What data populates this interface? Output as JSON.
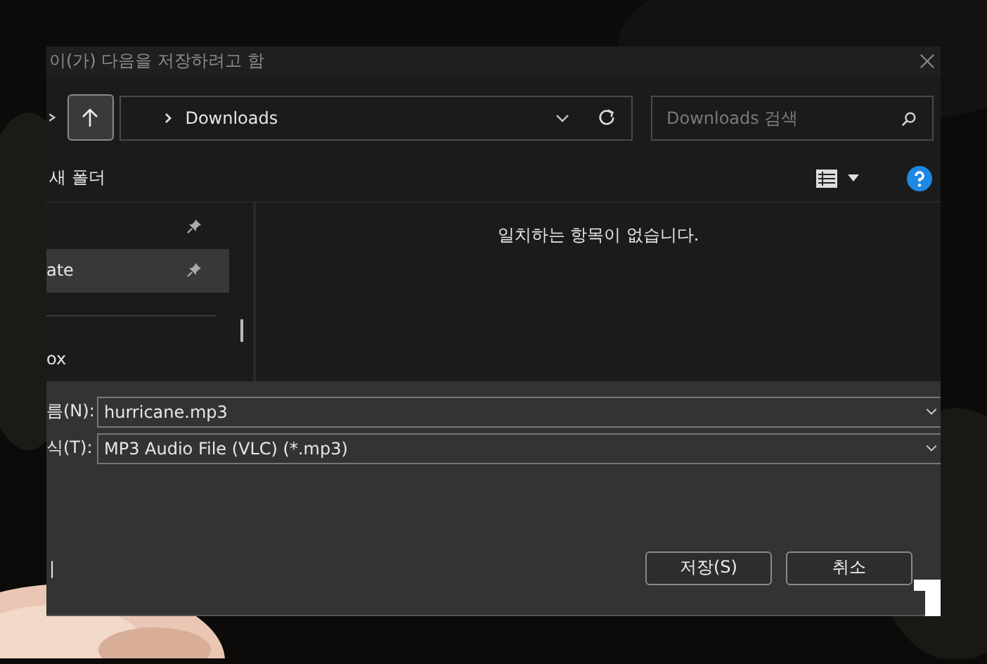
{
  "window": {
    "title": "이(가) 다음을 저장하려고 함"
  },
  "address_bar": {
    "path": "Downloads"
  },
  "search": {
    "placeholder": "Downloads 검색"
  },
  "command_bar": {
    "new_folder": "새 폴더"
  },
  "sidebar": {
    "items": [
      {
        "pinned": true,
        "selected": false,
        "kind": "item"
      },
      {
        "label": "ate",
        "pinned": true,
        "selected": true,
        "kind": "item"
      },
      {
        "kind": "divider"
      },
      {
        "label": "ox",
        "pinned": false,
        "selected": false,
        "kind": "item"
      }
    ]
  },
  "content": {
    "empty_message": "일치하는 항목이 없습니다."
  },
  "form": {
    "fields": [
      {
        "label": "름(N):",
        "value": "hurricane.mp3"
      },
      {
        "label": "식(T):",
        "value": "MP3 Audio File (VLC) (*.mp3)"
      }
    ]
  },
  "footer": {
    "left_mark": "|"
  },
  "buttons": [
    "저장(S)",
    "취소"
  ]
}
